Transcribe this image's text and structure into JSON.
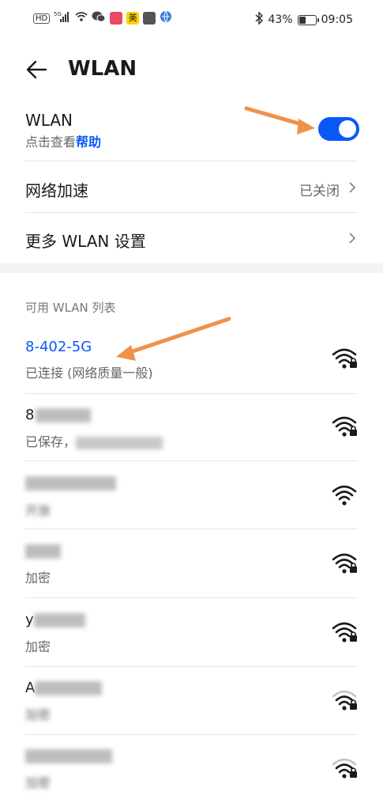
{
  "status_bar": {
    "left_icons": [
      "hd-icon",
      "signal-5g-icon",
      "wifi-status-icon",
      "wechat-icon",
      "notebook-app-icon",
      "meituan-app-icon",
      "calendar-app-icon",
      "globe-app-icon"
    ],
    "meituan_label": "美",
    "bluetooth_icon": "bluetooth-icon",
    "battery": "43%",
    "battery_fraction": 0.43,
    "time": "09:05"
  },
  "appbar": {
    "title": "WLAN"
  },
  "wlan_toggle": {
    "label": "WLAN",
    "sub_prefix": "点击查看",
    "sub_link": "帮助",
    "on": true,
    "accent": "#0a59f7"
  },
  "acceleration": {
    "label": "网络加速",
    "value": "已关闭"
  },
  "more_settings": {
    "label": "更多 WLAN 设置"
  },
  "networks_section": {
    "title": "可用 WLAN 列表"
  },
  "networks": [
    {
      "ssid": "8-402-5G",
      "status": "已连接 (网络质量一般)",
      "secured": true,
      "signal_level": 3,
      "connected": true
    },
    {
      "ssid": "8",
      "status": "已保存，",
      "secured": true,
      "signal_level": 4,
      "connected": false
    },
    {
      "ssid": "",
      "status": "开放",
      "secured": false,
      "signal_level": 4,
      "connected": false
    },
    {
      "ssid": "",
      "status": "加密",
      "secured": true,
      "signal_level": 3,
      "connected": false
    },
    {
      "ssid": "y",
      "status": "加密",
      "secured": true,
      "signal_level": 3,
      "connected": false
    },
    {
      "ssid": "A",
      "status": "加密",
      "secured": true,
      "signal_level": 2,
      "connected": false
    },
    {
      "ssid": "",
      "status": "加密",
      "secured": true,
      "signal_level": 2,
      "connected": false
    }
  ],
  "annotation_color": "#f0914a"
}
